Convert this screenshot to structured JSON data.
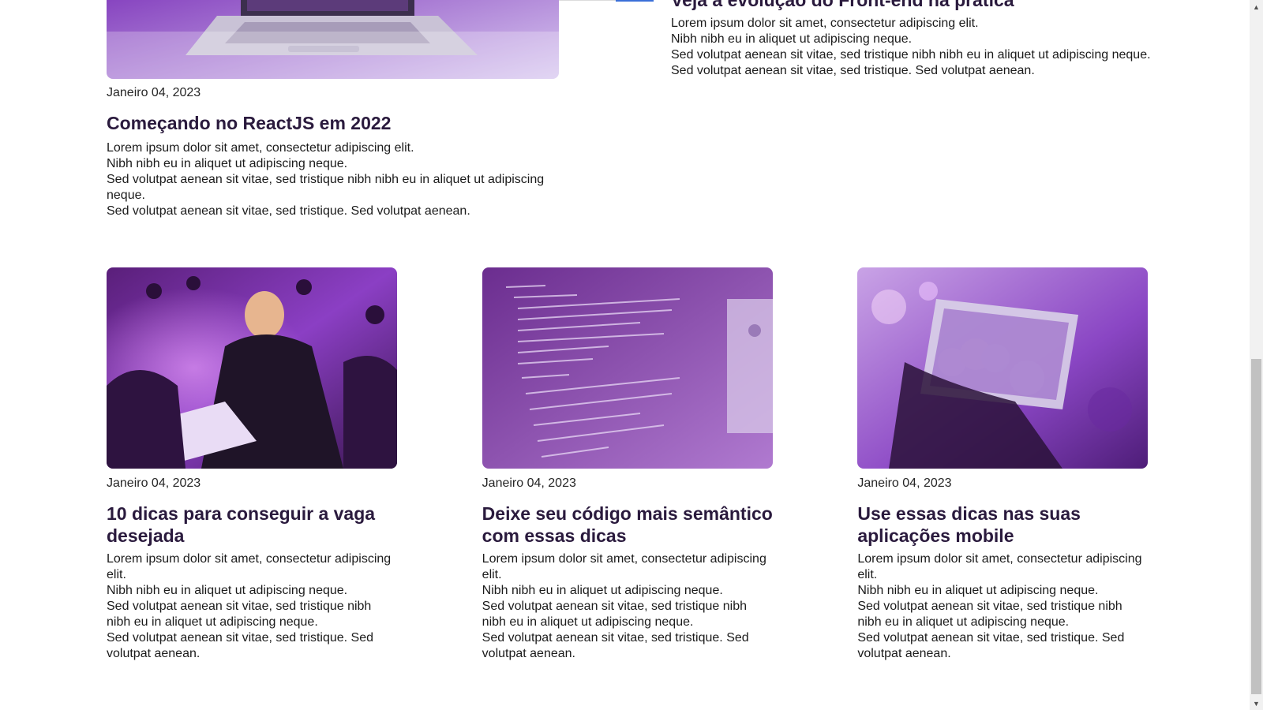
{
  "featured_post": {
    "date": "Janeiro 04, 2023",
    "title": "Começando no ReactJS em 2022",
    "body": [
      "Lorem ipsum dolor sit amet, consectetur adipiscing elit.",
      "Nibh nibh eu in aliquet ut adipiscing neque.",
      "Sed volutpat aenean sit vitae, sed tristique nibh nibh eu in aliquet ut adipiscing neque.",
      "Sed volutpat aenean sit vitae, sed tristique. Sed volutpat aenean."
    ],
    "image_icon": "laptop-photo"
  },
  "side_post": {
    "title": "Veja a evolução do Front-end na prática",
    "body": [
      "Lorem ipsum dolor sit amet, consectetur adipiscing elit.",
      "Nibh nibh eu in aliquet ut adipiscing neque.",
      "Sed volutpat aenean sit vitae, sed tristique nibh nibh eu in aliquet ut adipiscing neque.",
      "Sed volutpat aenean sit vitae, sed tristique. Sed volutpat aenean."
    ]
  },
  "cards": [
    {
      "date": "Janeiro 04, 2023",
      "title": "10 dicas para conseguir a vaga desejada",
      "body": [
        "Lorem ipsum dolor sit amet, consectetur adipiscing elit.",
        "Nibh nibh eu in aliquet ut adipiscing neque.",
        "Sed volutpat aenean sit vitae, sed tristique nibh nibh eu in aliquet ut adipiscing neque.",
        "Sed volutpat aenean sit vitae, sed tristique. Sed volutpat aenean."
      ],
      "image_icon": "people-laptops-photo"
    },
    {
      "date": "Janeiro 04, 2023",
      "title": "Deixe seu código mais semântico com essas dicas",
      "body": [
        "Lorem ipsum dolor sit amet, consectetur adipiscing elit.",
        "Nibh nibh eu in aliquet ut adipiscing neque.",
        "Sed volutpat aenean sit vitae, sed tristique nibh nibh eu in aliquet ut adipiscing neque.",
        "Sed volutpat aenean sit vitae, sed tristique. Sed volutpat aenean."
      ],
      "image_icon": "code-screen-photo"
    },
    {
      "date": "Janeiro 04, 2023",
      "title": "Use essas dicas nas suas aplicações mobile",
      "body": [
        "Lorem ipsum dolor sit amet, consectetur adipiscing elit.",
        "Nibh nibh eu in aliquet ut adipiscing neque.",
        "Sed volutpat aenean sit vitae, sed tristique nibh nibh eu in aliquet ut adipiscing neque.",
        "Sed volutpat aenean sit vitae, sed tristique. Sed volutpat aenean."
      ],
      "image_icon": "smartphone-photo"
    }
  ],
  "colors": {
    "title": "#2a1a3d",
    "photo_tint": "#8a3fd1",
    "scrollbar_thumb": "#c1c1c1"
  },
  "scrollbar": {
    "up_icon": "arrow-up-icon",
    "down_icon": "arrow-down-icon"
  }
}
